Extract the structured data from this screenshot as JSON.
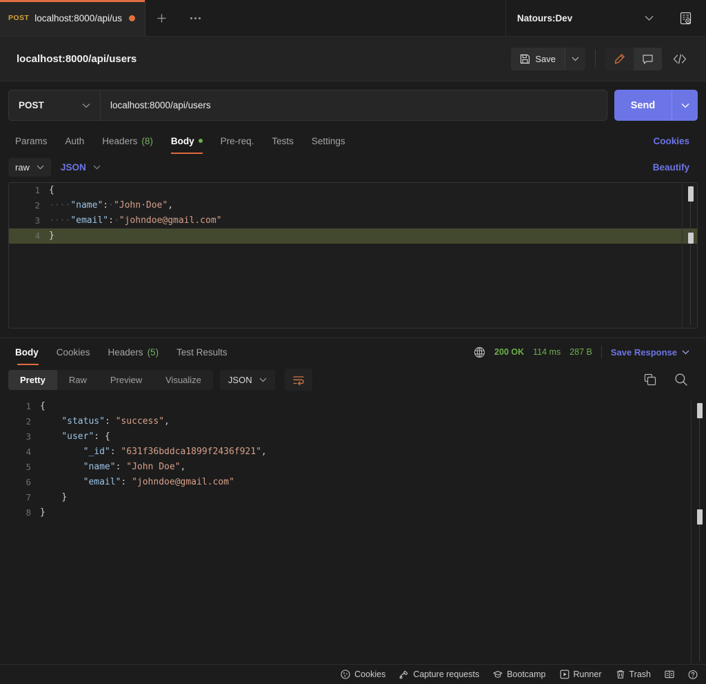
{
  "tabbar": {
    "tab": {
      "method": "POST",
      "title": "localhost:8000/api/us",
      "unsaved": true
    },
    "new_tab_label": "+",
    "more_label": "•••",
    "environment": {
      "name": "Natours:Dev",
      "eye_icon": "environment-quick-look-icon"
    }
  },
  "header": {
    "request_name": "localhost:8000/api/users",
    "save_label": "Save",
    "save_icon": "floppy-disk-icon",
    "save_caret_icon": "chevron-down-icon",
    "edit_icon": "pencil-icon",
    "comment_icon": "comment-icon",
    "code_icon": "code-brackets-icon"
  },
  "urlbar": {
    "method": "POST",
    "url": "localhost:8000/api/users",
    "send_label": "Send",
    "send_caret_icon": "chevron-down-icon",
    "send_color": "#6c75e6"
  },
  "request_tabs": [
    {
      "label": "Params",
      "active": false
    },
    {
      "label": "Auth",
      "active": false
    },
    {
      "label": "Headers",
      "count": "(8)",
      "active": false
    },
    {
      "label": "Body",
      "active": true,
      "dot": true
    },
    {
      "label": "Pre-req.",
      "active": false
    },
    {
      "label": "Tests",
      "active": false
    },
    {
      "label": "Settings",
      "active": false
    }
  ],
  "request_tabs_right": {
    "cookies_label": "Cookies"
  },
  "body_controls": {
    "mode": "raw",
    "format": "JSON",
    "beautify_label": "Beautify",
    "caret_icon": "chevron-down-icon"
  },
  "request_body": {
    "lines": [
      {
        "n": "1",
        "segments": [
          {
            "t": "{",
            "c": "brace"
          }
        ],
        "highlight": false
      },
      {
        "n": "2",
        "segments": [
          {
            "t": "····",
            "c": "dots"
          },
          {
            "t": "\"name\"",
            "c": "key"
          },
          {
            "t": ":",
            "c": "punc"
          },
          {
            "t": "·",
            "c": "dots"
          },
          {
            "t": "\"John·Doe\"",
            "c": "str"
          },
          {
            "t": ",",
            "c": "punc"
          }
        ],
        "highlight": false
      },
      {
        "n": "3",
        "segments": [
          {
            "t": "····",
            "c": "dots"
          },
          {
            "t": "\"email\"",
            "c": "key"
          },
          {
            "t": ":",
            "c": "punc"
          },
          {
            "t": "·",
            "c": "dots"
          },
          {
            "t": "\"johndoe@gmail.com\"",
            "c": "str"
          }
        ],
        "highlight": false
      },
      {
        "n": "4",
        "segments": [
          {
            "t": "}",
            "c": "brace"
          }
        ],
        "highlight": true
      }
    ]
  },
  "response": {
    "tabs": [
      {
        "label": "Body",
        "active": true
      },
      {
        "label": "Cookies",
        "active": false
      },
      {
        "label": "Headers",
        "count": "(5)",
        "active": false
      },
      {
        "label": "Test Results",
        "active": false
      }
    ],
    "globe_icon": "globe-icon",
    "status": "200 OK",
    "time": "114 ms",
    "size": "287 B",
    "save_response_label": "Save Response",
    "save_response_caret": "chevron-down-icon",
    "view_modes": [
      {
        "label": "Pretty",
        "active": true
      },
      {
        "label": "Raw",
        "active": false
      },
      {
        "label": "Preview",
        "active": false
      },
      {
        "label": "Visualize",
        "active": false
      }
    ],
    "format": "JSON",
    "wrap_icon": "word-wrap-icon",
    "copy_icon": "copy-icon",
    "search_icon": "search-icon",
    "body_lines": [
      {
        "n": "1",
        "segments": [
          {
            "t": "{",
            "c": "brace"
          }
        ]
      },
      {
        "n": "2",
        "segments": [
          {
            "t": "    ",
            "c": "punc"
          },
          {
            "t": "\"status\"",
            "c": "key"
          },
          {
            "t": ": ",
            "c": "punc"
          },
          {
            "t": "\"success\"",
            "c": "str"
          },
          {
            "t": ",",
            "c": "punc"
          }
        ]
      },
      {
        "n": "3",
        "segments": [
          {
            "t": "    ",
            "c": "punc"
          },
          {
            "t": "\"user\"",
            "c": "key"
          },
          {
            "t": ": ",
            "c": "punc"
          },
          {
            "t": "{",
            "c": "brace"
          }
        ]
      },
      {
        "n": "4",
        "segments": [
          {
            "t": "        ",
            "c": "punc"
          },
          {
            "t": "\"_id\"",
            "c": "key"
          },
          {
            "t": ": ",
            "c": "punc"
          },
          {
            "t": "\"631f36bddca1899f2436f921\"",
            "c": "str"
          },
          {
            "t": ",",
            "c": "punc"
          }
        ]
      },
      {
        "n": "5",
        "segments": [
          {
            "t": "        ",
            "c": "punc"
          },
          {
            "t": "\"name\"",
            "c": "key"
          },
          {
            "t": ": ",
            "c": "punc"
          },
          {
            "t": "\"John Doe\"",
            "c": "str"
          },
          {
            "t": ",",
            "c": "punc"
          }
        ]
      },
      {
        "n": "6",
        "segments": [
          {
            "t": "        ",
            "c": "punc"
          },
          {
            "t": "\"email\"",
            "c": "key"
          },
          {
            "t": ": ",
            "c": "punc"
          },
          {
            "t": "\"johndoe@gmail.com\"",
            "c": "str"
          }
        ]
      },
      {
        "n": "7",
        "segments": [
          {
            "t": "    ",
            "c": "punc"
          },
          {
            "t": "}",
            "c": "brace"
          }
        ]
      },
      {
        "n": "8",
        "segments": [
          {
            "t": "}",
            "c": "brace"
          }
        ]
      }
    ]
  },
  "bottombar": [
    {
      "label": "Cookies",
      "icon": "cookie-icon"
    },
    {
      "label": "Capture requests",
      "icon": "satellite-icon"
    },
    {
      "label": "Bootcamp",
      "icon": "graduation-cap-icon"
    },
    {
      "label": "Runner",
      "icon": "runner-play-icon"
    },
    {
      "label": "Trash",
      "icon": "trash-icon"
    },
    {
      "label": "",
      "icon": "two-pane-layout-icon"
    },
    {
      "label": "",
      "icon": "help-icon"
    }
  ]
}
